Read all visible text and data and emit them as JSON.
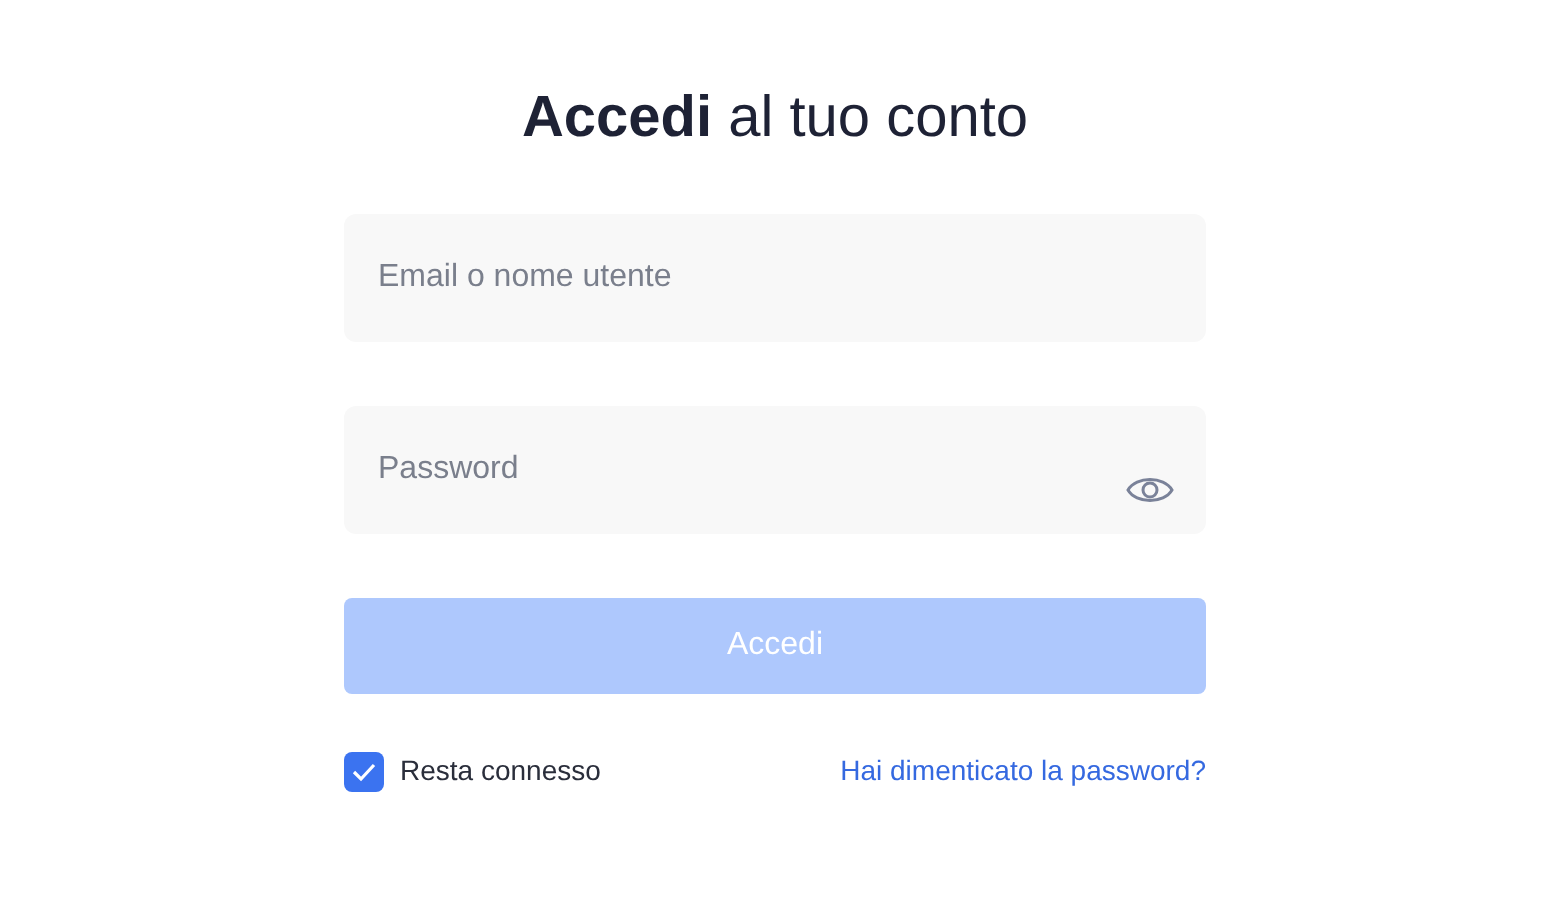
{
  "title": "**Accedi** al tuo conto",
  "fields": [
    {
      "kind": "text",
      "placeholder": "Email o nome utente"
    },
    {
      "kind": "password",
      "placeholder": "Password"
    }
  ],
  "submit": {
    "label": "Accedi",
    "disabled": true
  },
  "remember": {
    "label": "Resta connesso",
    "checked": true
  },
  "forgot_link": "Hai dimenticato la password?"
}
